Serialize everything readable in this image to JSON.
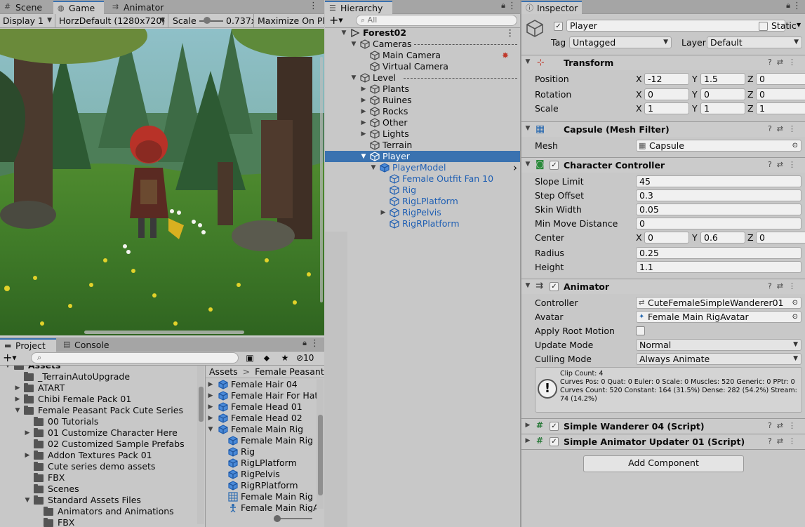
{
  "game": {
    "tabs": [
      "Scene",
      "Game",
      "Animator"
    ],
    "display": "Display 1",
    "resolution": "HorzDefault (1280x720)",
    "scale_label": "Scale",
    "scale_value": "0.737x",
    "maximize": "Maximize On Play"
  },
  "project": {
    "tabs": [
      "Project",
      "Console"
    ],
    "hidden_count": "10",
    "search_placeholder": "",
    "tree": [
      {
        "label": "Assets",
        "depth": 0,
        "open": true,
        "partial": true
      },
      {
        "label": "_TerrainAutoUpgrade",
        "depth": 1,
        "arrow": false
      },
      {
        "label": "ATART",
        "depth": 1,
        "arrow": true
      },
      {
        "label": "Chibi Female Pack 01",
        "depth": 1,
        "arrow": true
      },
      {
        "label": "Female Peasant Pack Cute Series",
        "depth": 1,
        "open": true
      },
      {
        "label": "00 Tutorials",
        "depth": 2,
        "arrow": false
      },
      {
        "label": "01 Customize Character Here",
        "depth": 2,
        "arrow": true
      },
      {
        "label": "02 Customized Sample Prefabs",
        "depth": 2,
        "arrow": false
      },
      {
        "label": "Addon Textures Pack 01",
        "depth": 2,
        "arrow": true
      },
      {
        "label": "Cute series demo assets",
        "depth": 2,
        "arrow": false
      },
      {
        "label": "FBX",
        "depth": 2,
        "arrow": false
      },
      {
        "label": "Scenes",
        "depth": 2,
        "arrow": false
      },
      {
        "label": "Standard Assets Files",
        "depth": 2,
        "open": true
      },
      {
        "label": "Animators and Animations",
        "depth": 3,
        "arrow": false
      },
      {
        "label": "FBX",
        "depth": 3,
        "arrow": false,
        "partial": true
      }
    ],
    "breadcrumb": [
      "Assets",
      "Female Peasant Pa"
    ],
    "assets": [
      {
        "label": "Female Hair 04",
        "depth": 0,
        "arrow": "closed",
        "icon": "prefab-icon"
      },
      {
        "label": "Female Hair For Hat",
        "depth": 0,
        "arrow": "closed",
        "icon": "prefab-icon"
      },
      {
        "label": "Female Head 01",
        "depth": 0,
        "arrow": "closed",
        "icon": "prefab-icon"
      },
      {
        "label": "Female Head 02",
        "depth": 0,
        "arrow": "closed",
        "icon": "prefab-icon"
      },
      {
        "label": "Female Main Rig",
        "depth": 0,
        "arrow": "open",
        "icon": "prefab-icon"
      },
      {
        "label": "Female Main Rig",
        "depth": 1,
        "arrow": "",
        "icon": "prefab-icon"
      },
      {
        "label": "Rig",
        "depth": 1,
        "arrow": "",
        "icon": "prefab-icon"
      },
      {
        "label": "RigLPlatform",
        "depth": 1,
        "arrow": "",
        "icon": "prefab-icon"
      },
      {
        "label": "RigPelvis",
        "depth": 1,
        "arrow": "",
        "icon": "prefab-icon"
      },
      {
        "label": "RigRPlatform",
        "depth": 1,
        "arrow": "",
        "icon": "prefab-icon"
      },
      {
        "label": "Female Main Rig",
        "depth": 1,
        "arrow": "",
        "icon": "mesh-icon"
      },
      {
        "label": "Female Main RigAv",
        "depth": 1,
        "arrow": "",
        "icon": "avatar-icon",
        "partial": true
      }
    ]
  },
  "hierarchy": {
    "tab": "Hierarchy",
    "search_placeholder": "All",
    "rows": [
      {
        "label": "Forest02",
        "depth": 0,
        "arrow": "open",
        "icon": "scene-icon",
        "bold": true
      },
      {
        "label": "Cameras",
        "depth": 1,
        "arrow": "open",
        "icon": "cube-icon",
        "dashed": true
      },
      {
        "label": "Main Camera",
        "depth": 2,
        "arrow": "",
        "icon": "cube-icon",
        "camera": true
      },
      {
        "label": "Virtual Camera",
        "depth": 2,
        "arrow": "",
        "icon": "cube-icon"
      },
      {
        "label": "Level",
        "depth": 1,
        "arrow": "open",
        "icon": "cube-icon",
        "dashed": true
      },
      {
        "label": "Plants",
        "depth": 2,
        "arrow": "closed",
        "icon": "cube-icon"
      },
      {
        "label": "Ruines",
        "depth": 2,
        "arrow": "closed",
        "icon": "cube-icon"
      },
      {
        "label": "Rocks",
        "depth": 2,
        "arrow": "closed",
        "icon": "cube-icon"
      },
      {
        "label": "Other",
        "depth": 2,
        "arrow": "closed",
        "icon": "cube-icon"
      },
      {
        "label": "Lights",
        "depth": 2,
        "arrow": "closed",
        "icon": "cube-icon"
      },
      {
        "label": "Terrain",
        "depth": 2,
        "arrow": "",
        "icon": "cube-icon"
      },
      {
        "label": "Player",
        "depth": 2,
        "arrow": "open",
        "icon": "cube-icon",
        "selected": true
      },
      {
        "label": "PlayerModel",
        "depth": 3,
        "arrow": "open",
        "icon": "prefab-icon",
        "blue": true,
        "chevron": true
      },
      {
        "label": "Female Outfit Fan 10",
        "depth": 4,
        "arrow": "",
        "icon": "cube-icon",
        "blue": true
      },
      {
        "label": "Rig",
        "depth": 4,
        "arrow": "",
        "icon": "cube-icon",
        "blue": true
      },
      {
        "label": "RigLPlatform",
        "depth": 4,
        "arrow": "",
        "icon": "cube-icon",
        "blue": true
      },
      {
        "label": "RigPelvis",
        "depth": 4,
        "arrow": "closed",
        "icon": "cube-icon",
        "blue": true
      },
      {
        "label": "RigRPlatform",
        "depth": 4,
        "arrow": "",
        "icon": "cube-icon",
        "blue": true
      }
    ]
  },
  "inspector": {
    "tab": "Inspector",
    "object_name": "Player",
    "static_label": "Static",
    "tag_label": "Tag",
    "tag_value": "Untagged",
    "layer_label": "Layer",
    "layer_value": "Default",
    "transform": {
      "title": "Transform",
      "position_label": "Position",
      "px": "-12",
      "py": "1.5",
      "pz": "0",
      "rotation_label": "Rotation",
      "rx": "0",
      "ry": "0",
      "rz": "0",
      "scale_label": "Scale",
      "sx": "1",
      "sy": "1",
      "sz": "1"
    },
    "mesh_filter": {
      "title": "Capsule (Mesh Filter)",
      "mesh_label": "Mesh",
      "mesh_value": "Capsule"
    },
    "character_controller": {
      "title": "Character Controller",
      "slope_label": "Slope Limit",
      "slope": "45",
      "step_label": "Step Offset",
      "step": "0.3",
      "skin_label": "Skin Width",
      "skin": "0.05",
      "minmove_label": "Min Move Distance",
      "minmove": "0",
      "center_label": "Center",
      "cx": "0",
      "cy": "0.6",
      "cz": "0",
      "radius_label": "Radius",
      "radius": "0.25",
      "height_label": "Height",
      "height": "1.1"
    },
    "animator": {
      "title": "Animator",
      "controller_label": "Controller",
      "controller": "CuteFemaleSimpleWanderer01",
      "avatar_label": "Avatar",
      "avatar": "Female Main RigAvatar",
      "root_motion_label": "Apply Root Motion",
      "update_label": "Update Mode",
      "update": "Normal",
      "culling_label": "Culling Mode",
      "culling": "Always Animate",
      "info_line1": "Clip Count: 4",
      "info_line2": "Curves Pos: 0 Quat: 0 Euler: 0 Scale: 0 Muscles: 520 Generic: 0 PPtr: 0",
      "info_line3": "Curves Count: 520 Constant: 164 (31.5%) Dense: 282 (54.2%) Stream:",
      "info_line4": "74 (14.2%)"
    },
    "script1": "Simple Wanderer 04 (Script)",
    "script2": "Simple Animator Updater 01 (Script)",
    "add_component": "Add Component",
    "axis": {
      "x": "X",
      "y": "Y",
      "z": "Z"
    }
  },
  "colors": {
    "selection": "#3a72b0",
    "prefab_blue": "#1f5fb3",
    "panel": "#c8c8c8"
  }
}
